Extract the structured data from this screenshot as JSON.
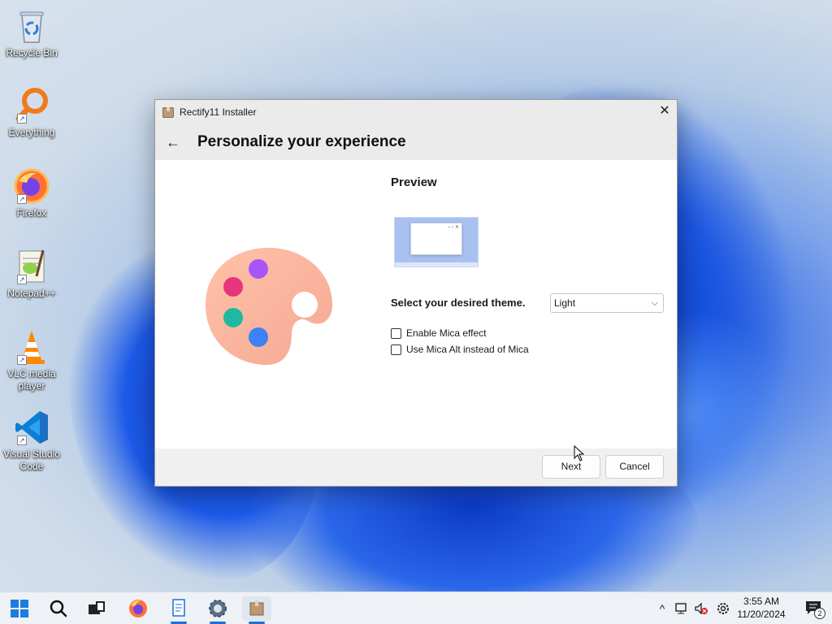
{
  "desktop": {
    "icons": [
      {
        "label": "Recycle Bin",
        "icon": "recycle-bin-icon"
      },
      {
        "label": "Everything",
        "icon": "everything-search-icon"
      },
      {
        "label": "Firefox",
        "icon": "firefox-icon"
      },
      {
        "label": "Notepad++",
        "icon": "notepad-plus-plus-icon"
      },
      {
        "label": "VLC media player",
        "icon": "vlc-icon"
      },
      {
        "label": "Visual Studio Code",
        "icon": "vscode-icon"
      }
    ]
  },
  "dialog": {
    "window_title": "Rectify11 Installer",
    "close_glyph": "✕",
    "back_glyph": "←",
    "heading": "Personalize your experience",
    "preview_label": "Preview",
    "theme_label": "Select your desired theme.",
    "theme_select": {
      "selected": "Light",
      "chevron": "⌵"
    },
    "checkboxes": [
      {
        "label": "Enable Mica effect",
        "checked": false
      },
      {
        "label": "Use Mica Alt instead of Mica",
        "checked": false
      }
    ],
    "buttons": {
      "next": "Next",
      "cancel": "Cancel"
    },
    "palette_colors": [
      "#e8347a",
      "#a855f7",
      "#22b8a0",
      "#3b82f6"
    ]
  },
  "taskbar": {
    "items": [
      "start-icon",
      "search-icon",
      "task-view-icon",
      "firefox-icon",
      "notepad-icon",
      "settings-icon",
      "installer-icon"
    ],
    "tray": {
      "chevron": "^"
    },
    "clock": {
      "time": "3:55 AM",
      "date": "11/20/2024"
    },
    "notification_count": "2"
  },
  "colors": {
    "accent": "#1f6fd6",
    "dialog_header": "#ebebeb"
  }
}
